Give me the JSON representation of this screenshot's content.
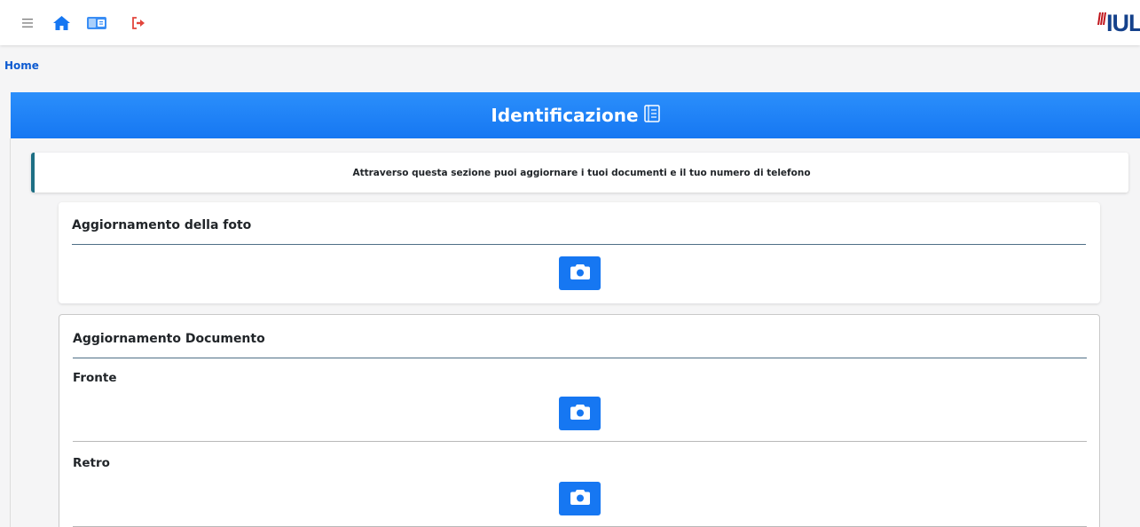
{
  "nav": {
    "icons": [
      "menu-icon",
      "home-icon",
      "id-card-icon",
      "logout-icon"
    ],
    "logo_text": "IUL"
  },
  "breadcrumb": {
    "home": "Home"
  },
  "header": {
    "title": "Identificazione",
    "icon": "book-icon"
  },
  "info": {
    "text": "Attraverso questa sezione puoi aggiornare i tuoi documenti e il tuo numero di telefono"
  },
  "photo_section": {
    "title": "Aggiornamento della foto"
  },
  "document_section": {
    "title": "Aggiornamento Documento",
    "front_label": "Fronte",
    "back_label": "Retro"
  },
  "colors": {
    "primary": "#1677f2",
    "header_blue": "#2b8ffb",
    "callout_accent": "#1d6f84",
    "logout_red": "#e2453c",
    "logo_blue": "#14418b",
    "logo_red": "#c0161d"
  }
}
